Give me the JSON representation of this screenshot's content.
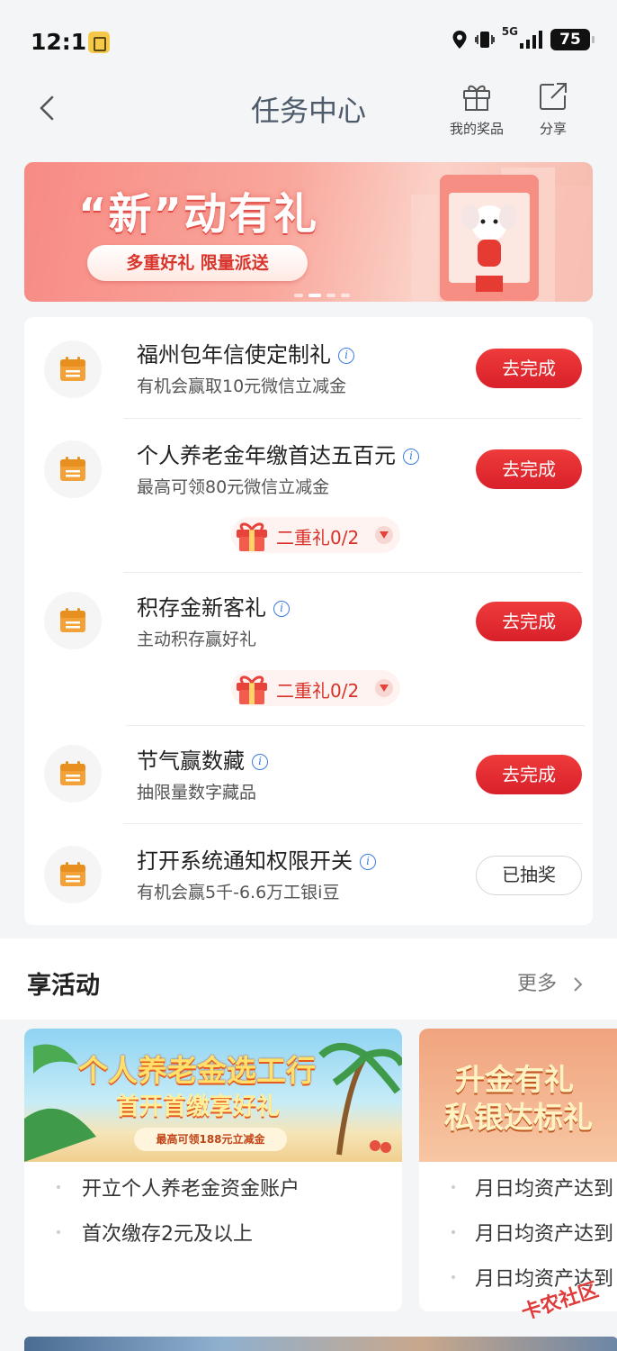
{
  "status": {
    "time": "12:11",
    "network": "5G",
    "battery": "75"
  },
  "header": {
    "title": "任务中心",
    "gift_label": "我的奖品",
    "share_label": "分享"
  },
  "banner": {
    "title": "“新”动有礼",
    "subtitle": "多重好礼 限量派送"
  },
  "tasks": [
    {
      "title": "福州包年信使定制礼",
      "desc": "有机会赢取10元微信立减金",
      "button": "去完成",
      "done": false
    },
    {
      "title": "个人养老金年缴首达五百元",
      "desc": "最高可领80元微信立减金",
      "button": "去完成",
      "done": false,
      "bonus": "二重礼0/2"
    },
    {
      "title": "积存金新客礼",
      "desc": "主动积存赢好礼",
      "button": "去完成",
      "done": false,
      "bonus": "二重礼0/2"
    },
    {
      "title": "节气赢数藏",
      "desc": "抽限量数字藏品",
      "button": "去完成",
      "done": false
    },
    {
      "title": "打开系统通知权限开关",
      "desc": "有机会赢5千-6.6万工银i豆",
      "button": "已抽奖",
      "done": true
    }
  ],
  "activities": {
    "title": "享活动",
    "more": "更多",
    "cards": [
      {
        "banner_line1": "个人养老金选工行",
        "banner_line2": "首开首缴享好礼",
        "banner_pill": "最高可领188元立减金",
        "items": [
          "开立个人养老金资金账户",
          "首次缴存2元及以上"
        ]
      },
      {
        "banner_line1": "升金有礼",
        "banner_line2": "私银达标礼",
        "items": [
          "月日均资产达到",
          "月日均资产达到",
          "月日均资产达到"
        ]
      }
    ]
  },
  "watermark": "卡农社区"
}
